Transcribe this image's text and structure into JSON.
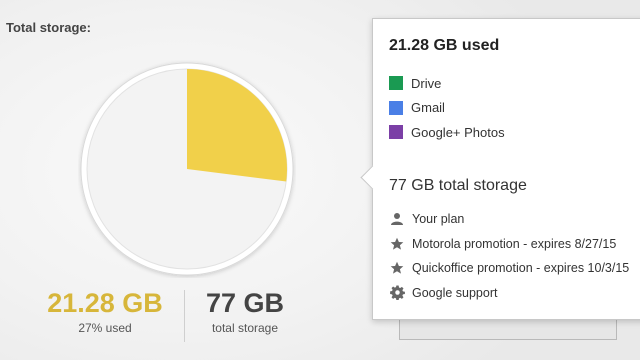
{
  "storage": {
    "section_title": "Total storage:",
    "used_value": "21.28 GB",
    "used_caption": "27% used",
    "total_value": "77 GB",
    "total_caption": "total storage",
    "used_percent": 27,
    "pie_color": "#f1d04a"
  },
  "popup": {
    "title": "21.28 GB used",
    "legend": [
      {
        "label": "Drive",
        "color": "#1a9a52"
      },
      {
        "label": "Gmail",
        "color": "#4a7fe6"
      },
      {
        "label": "Google+ Photos",
        "color": "#7b3fa6"
      }
    ],
    "total_line": "77 GB total storage",
    "links": [
      {
        "label": "Your plan",
        "icon": "person-icon"
      },
      {
        "label": "Motorola promotion - expires 8/27/15",
        "icon": "star-icon"
      },
      {
        "label": "Quickoffice promotion - expires 10/3/15",
        "icon": "star-icon"
      },
      {
        "label": "Google support",
        "icon": "gear-icon"
      }
    ]
  }
}
